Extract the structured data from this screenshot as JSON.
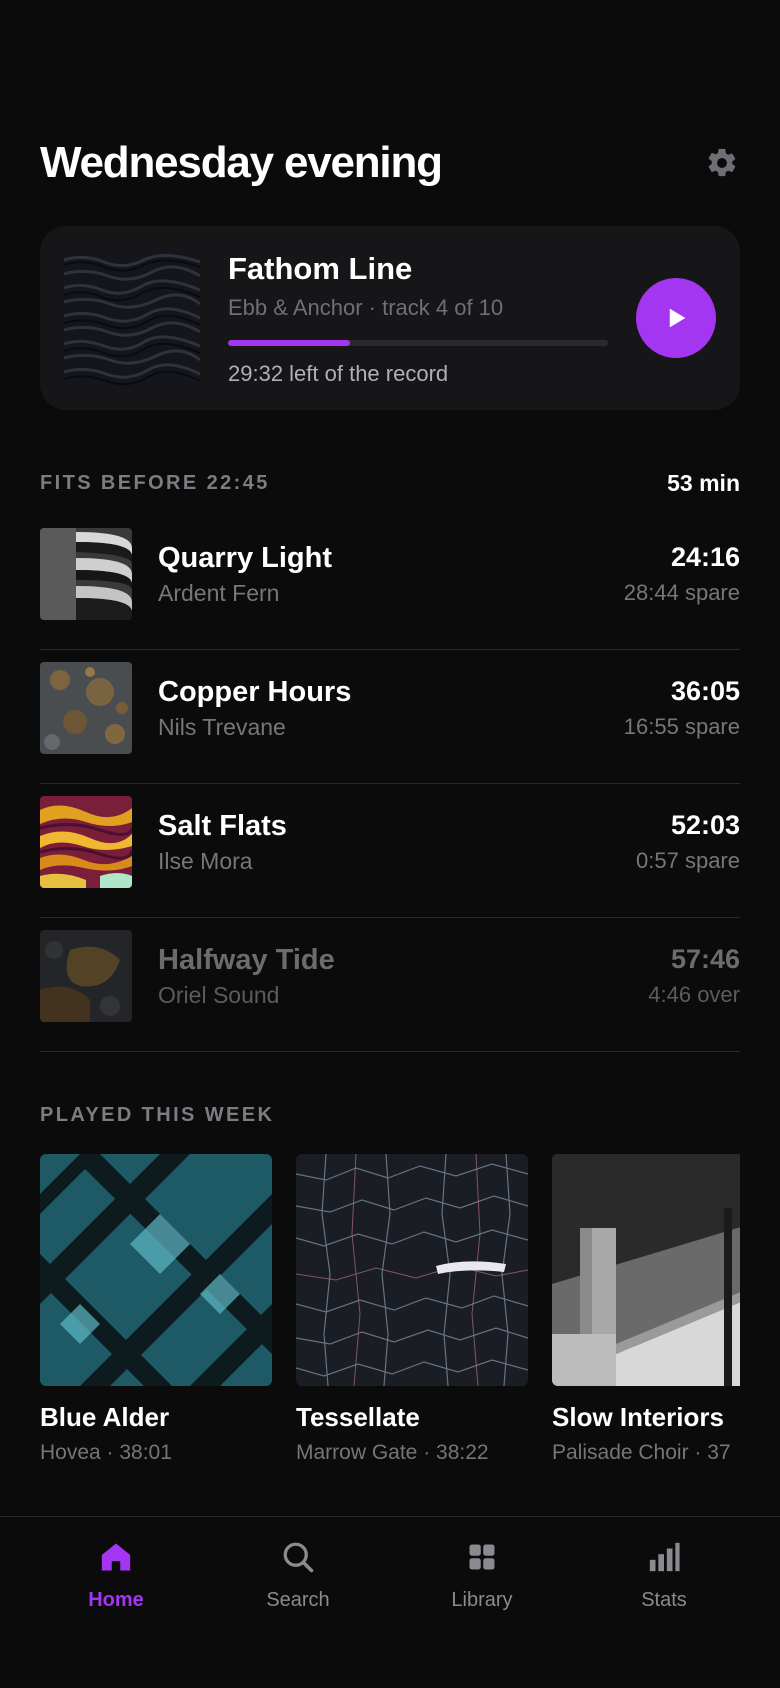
{
  "header": {
    "title": "Wednesday evening",
    "settings_icon": "gear-icon"
  },
  "now_playing": {
    "title": "Fathom Line",
    "subtitle": "Ebb & Anchor · track 4 of 10",
    "progress_fraction": 0.32,
    "time_left": "29:32 left of the record",
    "play_icon": "play-icon",
    "accent": "#a435f0"
  },
  "fits": {
    "label": "FITS BEFORE 22:45",
    "total": "53 min",
    "items": [
      {
        "title": "Quarry Light",
        "artist": "Ardent Fern",
        "time": "24:16",
        "spare": "28:44 spare",
        "fits": true
      },
      {
        "title": "Copper Hours",
        "artist": "Nils Trevane",
        "time": "36:05",
        "spare": "16:55 spare",
        "fits": true
      },
      {
        "title": "Salt Flats",
        "artist": "Ilse Mora",
        "time": "52:03",
        "spare": "0:57 spare",
        "fits": true
      },
      {
        "title": "Halfway Tide",
        "artist": "Oriel Sound",
        "time": "57:46",
        "spare": "4:46 over",
        "fits": false
      }
    ]
  },
  "played": {
    "label": "PLAYED THIS WEEK",
    "items": [
      {
        "title": "Blue Alder",
        "subtitle": "Hovea · 38:01"
      },
      {
        "title": "Tessellate",
        "subtitle": "Marrow Gate · 38:22"
      },
      {
        "title": "Slow Interiors",
        "subtitle": "Palisade Choir · 37"
      }
    ]
  },
  "tabs": [
    {
      "label": "Home",
      "icon": "home-icon",
      "active": true
    },
    {
      "label": "Search",
      "icon": "search-icon",
      "active": false
    },
    {
      "label": "Library",
      "icon": "grid-icon",
      "active": false
    },
    {
      "label": "Stats",
      "icon": "bar-chart-icon",
      "active": false
    }
  ]
}
